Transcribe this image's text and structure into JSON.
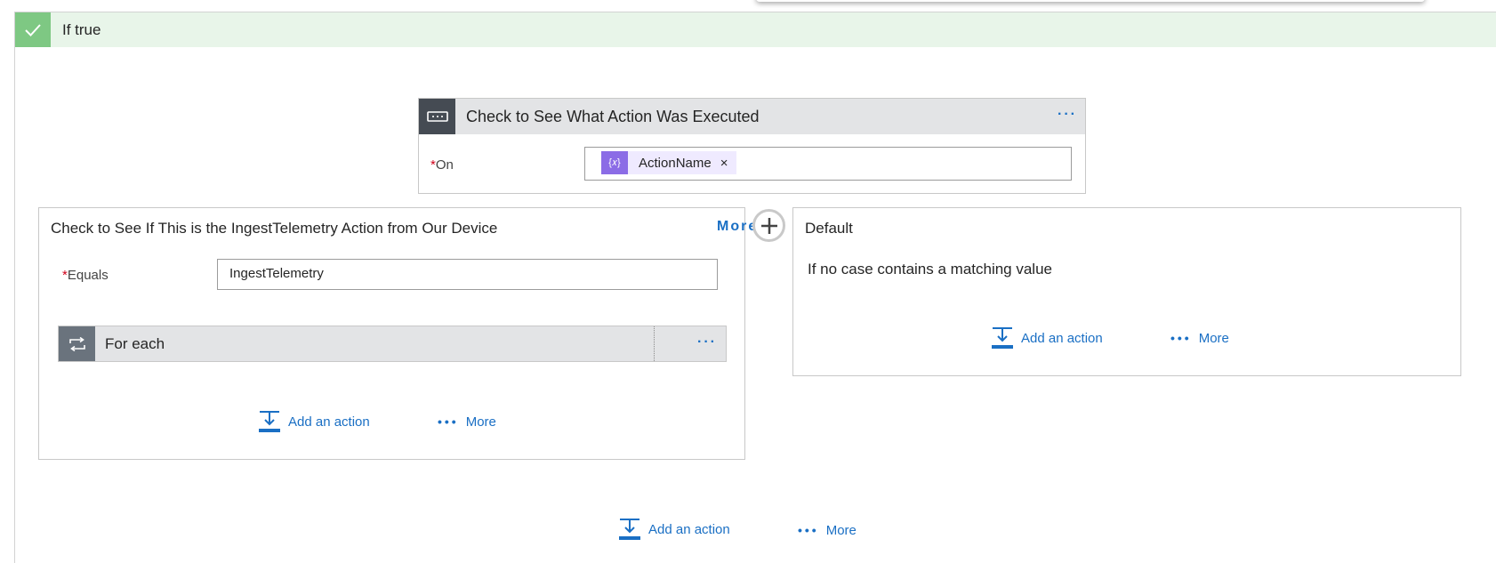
{
  "if_true": {
    "label": "If true"
  },
  "switch": {
    "title": "Check to See What Action Was Executed",
    "more": "···",
    "on_label": "On",
    "required_mark": "*",
    "token": {
      "icon": "{𝑥}",
      "text": "ActionName",
      "remove": "×"
    }
  },
  "case": {
    "title": "Check to See If This is the IngestTelemetry Action from Our Device",
    "more": "More",
    "equals_label": "Equals",
    "equals_value": "IngestTelemetry",
    "foreach_label": "For each",
    "foreach_more": "···",
    "add_action": "Add an action"
  },
  "default_case": {
    "title": "Default",
    "message": "If no case contains a matching value",
    "add_action": "Add an action",
    "more": "More"
  },
  "bottom": {
    "add_action": "Add an action",
    "more": "More"
  },
  "colors": {
    "accent": "#1a6fc4",
    "success_header": "#e8f5e9",
    "success_check": "#7ec883",
    "required": "#d0021b",
    "token_bg": "#efeaff",
    "token_icon": "#8b6ce6"
  }
}
